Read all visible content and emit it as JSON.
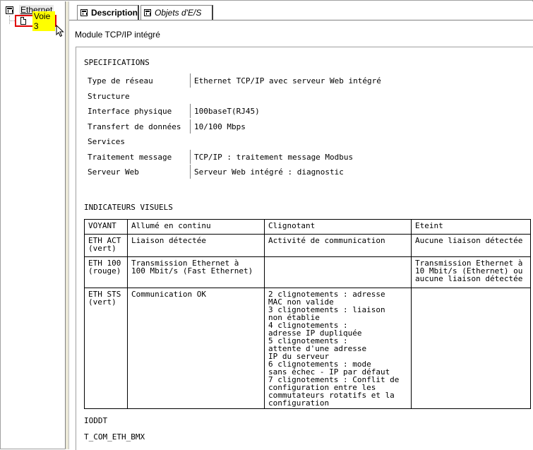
{
  "tree": {
    "root_label": "Ethernet",
    "child_label": "Voie 3"
  },
  "tabs": {
    "description": "Description",
    "io_objects": "Objets d'E/S"
  },
  "module_title": "Module TCP/IP intégré",
  "specifications": {
    "title": "SPECIFICATIONS",
    "rows": [
      {
        "key": "Type de réseau",
        "value": "Ethernet TCP/IP avec serveur Web intégré"
      },
      {
        "key": "Structure",
        "value": ""
      },
      {
        "key": "Interface physique",
        "value": "100baseT(RJ45)"
      },
      {
        "key": "Transfert de données",
        "value": "10/100 Mbps"
      },
      {
        "key": "Services",
        "value": ""
      },
      {
        "key": "Traitement message",
        "value": "TCP/IP : traitement message Modbus"
      },
      {
        "key": "Serveur Web",
        "value": "Serveur Web intégré : diagnostic"
      }
    ]
  },
  "indicators": {
    "title": "INDICATEURS VISUELS",
    "headers": [
      "VOYANT",
      "Allumé en continu",
      "Clignotant",
      "Eteint"
    ],
    "rows": [
      [
        "ETH ACT\n(vert)",
        "Liaison détectée",
        "Activité de communication",
        "Aucune liaison détectée"
      ],
      [
        "ETH 100\n(rouge)",
        "Transmission Ethernet à\n100 Mbit/s (Fast Ethernet)",
        "",
        "Transmission Ethernet à\n10 Mbit/s (Ethernet) ou\naucune liaison détectée"
      ],
      [
        "ETH STS\n(vert)",
        "Communication OK",
        "2 clignotements : adresse\nMAC non valide\n3 clignotements : liaison\nnon établie\n4 clignotements :\nadresse IP dupliquée\n5 clignotements :\nattente d'une adresse\nIP du serveur\n6 clignotements : mode\nsans échec - IP par défaut\n7 clignotements : Conflit de\nconfiguration entre les\ncommutateurs rotatifs et la\nconfiguration",
        ""
      ]
    ]
  },
  "ioddt": {
    "title": "IODDT",
    "value": "T_COM_ETH_BMX"
  }
}
